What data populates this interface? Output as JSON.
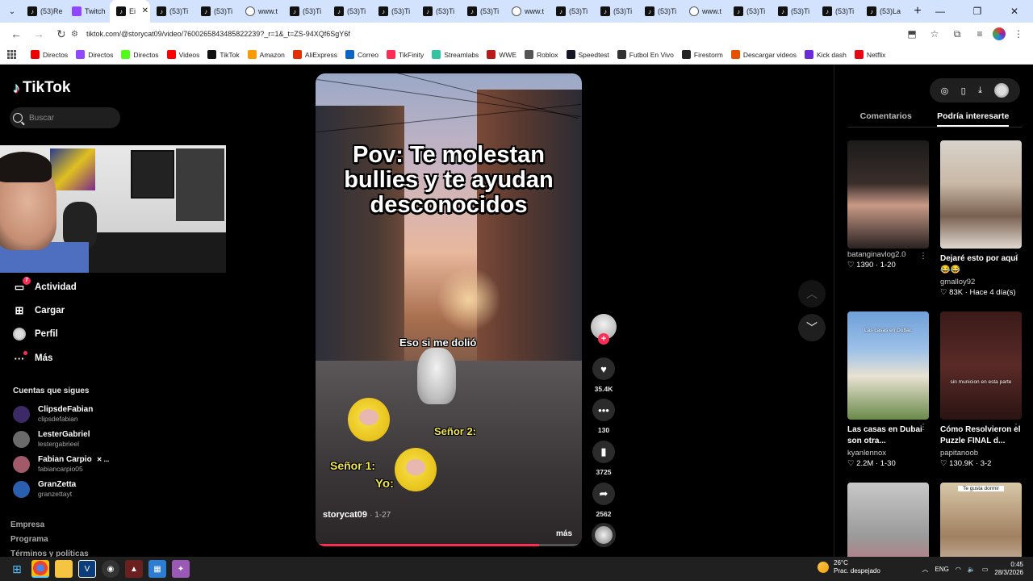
{
  "browser": {
    "tabs": [
      {
        "title": "(53)Re",
        "icon": "tiktok"
      },
      {
        "title": "Twitch",
        "icon": "twitch"
      },
      {
        "title": "Ei",
        "icon": "tiktok",
        "active": true
      },
      {
        "title": "(53)Ti",
        "icon": "tiktok"
      },
      {
        "title": "(53)Ti",
        "icon": "tiktok"
      },
      {
        "title": "www.t",
        "icon": "globe"
      },
      {
        "title": "(53)Ti",
        "icon": "tiktok"
      },
      {
        "title": "(53)Ti",
        "icon": "tiktok"
      },
      {
        "title": "(53)Ti",
        "icon": "tiktok"
      },
      {
        "title": "(53)Ti",
        "icon": "tiktok"
      },
      {
        "title": "(53)Ti",
        "icon": "tiktok"
      },
      {
        "title": "www.t",
        "icon": "globe"
      },
      {
        "title": "(53)Ti",
        "icon": "tiktok"
      },
      {
        "title": "(53)Ti",
        "icon": "tiktok"
      },
      {
        "title": "(53)Ti",
        "icon": "tiktok"
      },
      {
        "title": "www.t",
        "icon": "globe"
      },
      {
        "title": "(53)Ti",
        "icon": "tiktok"
      },
      {
        "title": "(53)Ti",
        "icon": "tiktok"
      },
      {
        "title": "(53)Ti",
        "icon": "tiktok"
      },
      {
        "title": "(53)La",
        "icon": "tiktok"
      }
    ],
    "url": "tiktok.com/@storycat09/video/7600265843485822239?_r=1&_t=ZS-94XQf6SgY6f",
    "bookmarks": [
      {
        "label": "Directos",
        "color": "#e00"
      },
      {
        "label": "Directos",
        "color": "#9146ff"
      },
      {
        "label": "Directos",
        "color": "#53fc18"
      },
      {
        "label": "Videos",
        "color": "#ff0000"
      },
      {
        "label": "TikTok",
        "color": "#111111"
      },
      {
        "label": "Amazon",
        "color": "#ff9900"
      },
      {
        "label": "AliExpress",
        "color": "#e62e04"
      },
      {
        "label": "Correo",
        "color": "#0a66c2"
      },
      {
        "label": "TikFinity",
        "color": "#fe2c55"
      },
      {
        "label": "Streamlabs",
        "color": "#31c3a2"
      },
      {
        "label": "WWE",
        "color": "#b71c1c"
      },
      {
        "label": "Roblox",
        "color": "#555555"
      },
      {
        "label": "Speedtest",
        "color": "#141526"
      },
      {
        "label": "Futbol En Vivo",
        "color": "#333333"
      },
      {
        "label": "Firestorm",
        "color": "#222222"
      },
      {
        "label": "Descargar videos",
        "color": "#e65100"
      },
      {
        "label": "Kick dash",
        "color": "#6b2bd9"
      },
      {
        "label": "Netflix",
        "color": "#e50914"
      }
    ]
  },
  "sidebar": {
    "logo": "TikTok",
    "search_placeholder": "Buscar",
    "nav": [
      {
        "label": "Actividad",
        "badge": "7"
      },
      {
        "label": "Cargar"
      },
      {
        "label": "Perfil"
      },
      {
        "label": "Más"
      }
    ],
    "following_title": "Cuentas que sigues",
    "following": [
      {
        "name": "ClipsdeFabian",
        "handle": "clipsdefabian",
        "color": "#3b2a66"
      },
      {
        "name": "LesterGabriel",
        "handle": "lestergabrieel",
        "color": "#6a6a6a"
      },
      {
        "name": "Fabian Carpio",
        "handle": "fabiancarpio05",
        "color": "#a05a6a",
        "extra": "✕ ..."
      },
      {
        "name": "GranZetta",
        "handle": "granzettayt",
        "color": "#2a5fb0"
      }
    ],
    "footer": [
      "Empresa",
      "Programa",
      "Términos y políticas"
    ]
  },
  "video": {
    "title": "Pov: Te molestan bullies y te ayudan desconocidos",
    "caption_eso": "Eso si me dolió",
    "caption_senor2": "Señor 2:",
    "caption_senor1": "Señor 1:",
    "caption_yo": "Yo:",
    "author": "storycat09",
    "date": "· 1-27",
    "more": "más",
    "progress": 0.84
  },
  "actions": {
    "likes": "35.4K",
    "comments": "130",
    "saves": "3725",
    "shares": "2562"
  },
  "right_panel": {
    "tabs": [
      "Comentarios",
      "Podría interesarte"
    ],
    "selected_tab": "Podría interesarte",
    "cards": [
      {
        "title": "",
        "user": "batanginavlog2.0",
        "stats": "♡ 1390 · 1-20",
        "overlay": ""
      },
      {
        "title": "Dejaré esto por aquí 😂😂",
        "user": "gmalloy92",
        "stats": "♡ 83K · Hace 4 día(s)",
        "overlay": ""
      },
      {
        "title": "Las casas en Dubai son otra...",
        "user": "kyanlennox",
        "stats": "♡ 2.2M · 1-30",
        "overlay": "Las casas en Dubai:"
      },
      {
        "title": "Cómo Resolvieron el Puzzle FINAL d...",
        "user": "papitanoob",
        "stats": "♡ 130.9K · 3-2",
        "overlay": "sin municion en esta parte"
      },
      {
        "title": "",
        "user": "",
        "stats": "",
        "overlay": ""
      },
      {
        "title": "",
        "user": "",
        "stats": "",
        "overlay": "Te gusta dormir"
      }
    ]
  },
  "taskbar": {
    "temp": "26°C",
    "weather": "Prac. despejado",
    "lang": "ENG",
    "time": "0:45",
    "date": "28/3/2026"
  }
}
